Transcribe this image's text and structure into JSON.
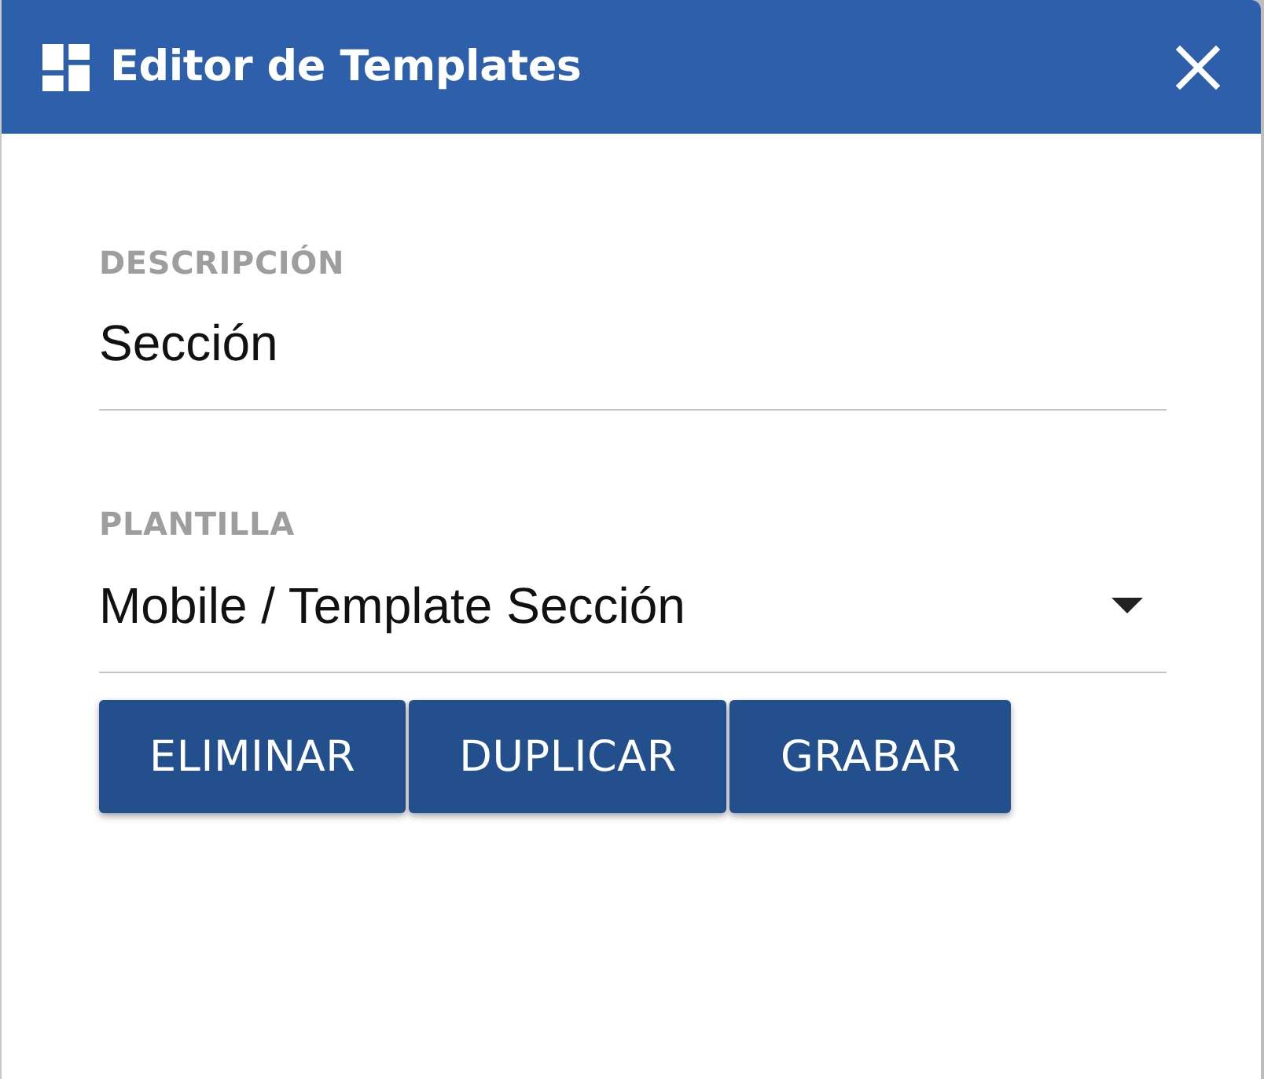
{
  "dialog": {
    "title": "Editor de Templates"
  },
  "fields": [
    {
      "kind": "text",
      "label": "DESCRIPCIÓN",
      "value": "Sección"
    },
    {
      "kind": "select",
      "label": "PLANTILLA",
      "value": "Mobile / Template Sección"
    }
  ],
  "buttons": [
    "ELIMINAR",
    "DUPLICAR",
    "GRABAR"
  ]
}
